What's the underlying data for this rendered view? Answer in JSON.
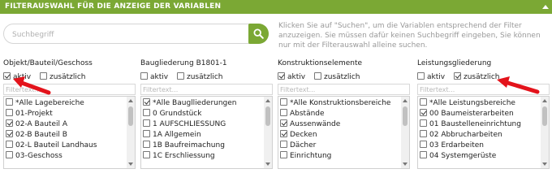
{
  "header": {
    "title": "FILTERAUSWAHL FÜR DIE ANZEIGE DER VARIABLEN"
  },
  "search": {
    "placeholder": "Suchbegriff"
  },
  "hint": "Klicken Sie auf \"Suchen\", um die Variablen entsprechend der Filter anzuzeigen. Sie müssen dafür keinen Suchbegriff eingeben, Sie können nur mit der Filterauswahl alleine suchen.",
  "colors": {
    "accent": "#7ba834",
    "annotation_arrow": "#e3131b"
  },
  "columns": [
    {
      "title": "Objekt/Bauteil/Geschoss",
      "aktiv_label": "aktiv",
      "aktiv_checked": true,
      "zusaetzlich_label": "zusätzlich",
      "zusaetzlich_checked": false,
      "filter_placeholder": "Filtertext...",
      "items": [
        {
          "label": "*Alle Lagebereiche",
          "checked": false
        },
        {
          "label": "01-Projekt",
          "checked": false
        },
        {
          "label": "02-A Bauteil A",
          "checked": true
        },
        {
          "label": "02-B Bauteil B",
          "checked": true
        },
        {
          "label": "02-L Bauteil Landhaus",
          "checked": false
        },
        {
          "label": "03-Geschoss",
          "checked": false
        }
      ]
    },
    {
      "title": "Baugliederung B1801-1",
      "aktiv_label": "aktiv",
      "aktiv_checked": false,
      "zusaetzlich_label": "zusätzlich",
      "zusaetzlich_checked": false,
      "filter_placeholder": "Filtertext...",
      "items": [
        {
          "label": "*Alle Bauglliederungen",
          "checked": true
        },
        {
          "label": "0 Grundstück",
          "checked": false
        },
        {
          "label": "1 AUFSCHLIESSUNG",
          "checked": false
        },
        {
          "label": "1A Allgemein",
          "checked": false
        },
        {
          "label": "1B Baufreimachung",
          "checked": false
        },
        {
          "label": "1C Erschliessung",
          "checked": false
        }
      ]
    },
    {
      "title": "Konstruktionselemente",
      "aktiv_label": "aktiv",
      "aktiv_checked": true,
      "zusaetzlich_label": "zusätzlich",
      "zusaetzlich_checked": false,
      "filter_placeholder": "Filtertext...",
      "items": [
        {
          "label": "*Alle Konstruktionsbereiche",
          "checked": false
        },
        {
          "label": "Abstände",
          "checked": false
        },
        {
          "label": "Aussenwände",
          "checked": true
        },
        {
          "label": "Decken",
          "checked": true
        },
        {
          "label": "Dächer",
          "checked": false
        },
        {
          "label": "Einrichtung",
          "checked": false
        }
      ]
    },
    {
      "title": "Leistungsgliederung",
      "aktiv_label": "aktiv",
      "aktiv_checked": false,
      "zusaetzlich_label": "zusätzlich",
      "zusaetzlich_checked": true,
      "filter_placeholder": "Filtertext...",
      "items": [
        {
          "label": "*Alle Leistungsbereiche",
          "checked": false
        },
        {
          "label": "00 Baumeisterarbeiten",
          "checked": true
        },
        {
          "label": "01 Baustelleneinrichtung",
          "checked": false
        },
        {
          "label": "02 Abbrucharbeiten",
          "checked": false
        },
        {
          "label": "03 Erdarbeiten",
          "checked": false
        },
        {
          "label": "04 Systemgerüste",
          "checked": false
        }
      ]
    }
  ]
}
